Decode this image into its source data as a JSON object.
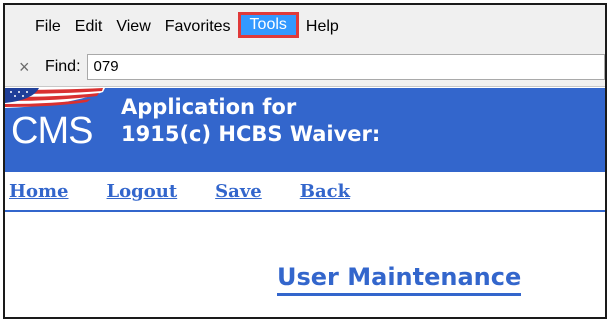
{
  "menu": {
    "items": [
      "File",
      "Edit",
      "View",
      "Favorites",
      "Tools",
      "Help"
    ]
  },
  "find_bar": {
    "close_glyph": "×",
    "label": "Find:",
    "value": "079"
  },
  "header": {
    "logo_text": "CMS",
    "title_line1": "Application for",
    "title_line2": "1915(c) HCBS Waiver:",
    "background_color": "#3366cc"
  },
  "nav": {
    "home": "Home",
    "logout": "Logout",
    "save": "Save",
    "back": "Back"
  },
  "page": {
    "title": "User Maintenance"
  },
  "colors": {
    "link": "#3366cc",
    "menu_highlight": "#3399ff",
    "annotation_box": "#e03a3a"
  }
}
